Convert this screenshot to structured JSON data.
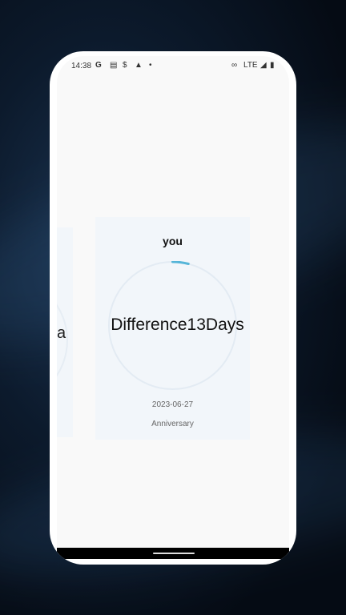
{
  "status_bar": {
    "time": "14:38",
    "icons": [
      "google-icon",
      "news-icon",
      "s-icon",
      "warning-icon",
      "dot-icon",
      "link-icon",
      "signal-icon",
      "battery-icon"
    ],
    "network": "LTE"
  },
  "side_card": {
    "text": "a"
  },
  "card": {
    "name": "you",
    "center_text": "Difference13Days",
    "date": "2023-06-27",
    "type": "Anniversary",
    "progress": 0.04,
    "accent_color": "#56b5d8"
  }
}
